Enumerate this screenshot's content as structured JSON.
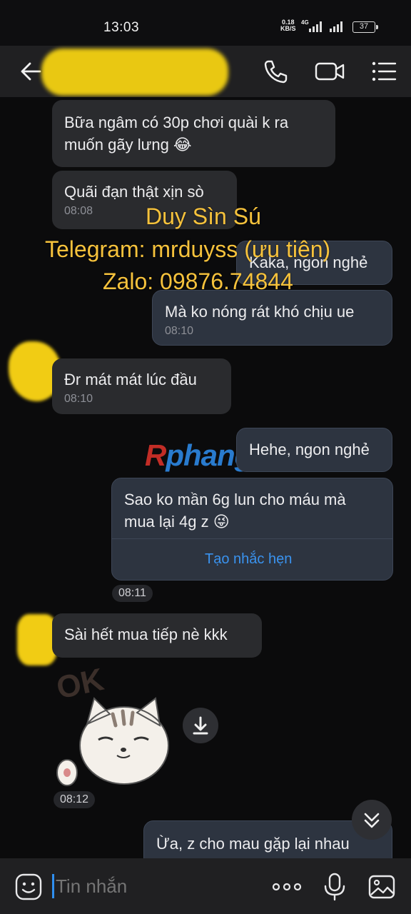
{
  "status_bar": {
    "time": "13:03",
    "speed_value": "0.18",
    "speed_unit": "KB/S",
    "network": "4G",
    "battery": "37"
  },
  "header": {
    "contact_name": ""
  },
  "messages": [
    {
      "id": "m1",
      "direction": "in",
      "lines": [
        "Bữa ngâm có 30p chơi quài k ra",
        "muốn gãy lưng 😂"
      ],
      "time": ""
    },
    {
      "id": "m2",
      "direction": "in",
      "lines": [
        "Quãi đạn thật xịn sò"
      ],
      "time": "08:08"
    },
    {
      "id": "m3",
      "direction": "out",
      "lines": [
        "Kaka, ngon nghẻ"
      ],
      "time": ""
    },
    {
      "id": "m4",
      "direction": "out",
      "lines": [
        "Mà ko nóng rát khó chịu ue"
      ],
      "time": "08:10"
    },
    {
      "id": "m5",
      "direction": "in",
      "lines": [
        "Đr mát mát lúc đầu"
      ],
      "time": "08:10"
    },
    {
      "id": "m6",
      "direction": "out",
      "lines": [
        "Hehe, ngon nghẻ"
      ],
      "time": ""
    },
    {
      "id": "m7",
      "direction": "out",
      "lines": [
        "Sao ko mần 6g lun cho máu mà",
        "mua lại 4g z 😜"
      ],
      "time": ""
    },
    {
      "id": "m8",
      "direction": "in",
      "lines": [
        "Sài hết mua tiếp nè kkk"
      ],
      "time": ""
    },
    {
      "id": "m9",
      "direction": "out",
      "lines": [
        "Ừa, z cho mau gặp lại nhau"
      ],
      "time": ""
    }
  ],
  "reminder_label": "Tạo nhắc hẹn",
  "time_pills": {
    "t1": "08:11",
    "t2": "08:12"
  },
  "sticker": {
    "text": "OK"
  },
  "watermark": {
    "line1": "Duy Sìn Sú",
    "line2": "Telegram: mrduyss (ưu tiên)",
    "line3": "Zalo: 09876.74844"
  },
  "logo": {
    "first": "R",
    "rest": "phang"
  },
  "composer": {
    "placeholder": "Tin nhắn"
  },
  "colors": {
    "accent": "#2f8ff0",
    "watermark": "#f6c23c",
    "bubble_in": "#2a2b2e",
    "bubble_out": "#2d3440"
  }
}
